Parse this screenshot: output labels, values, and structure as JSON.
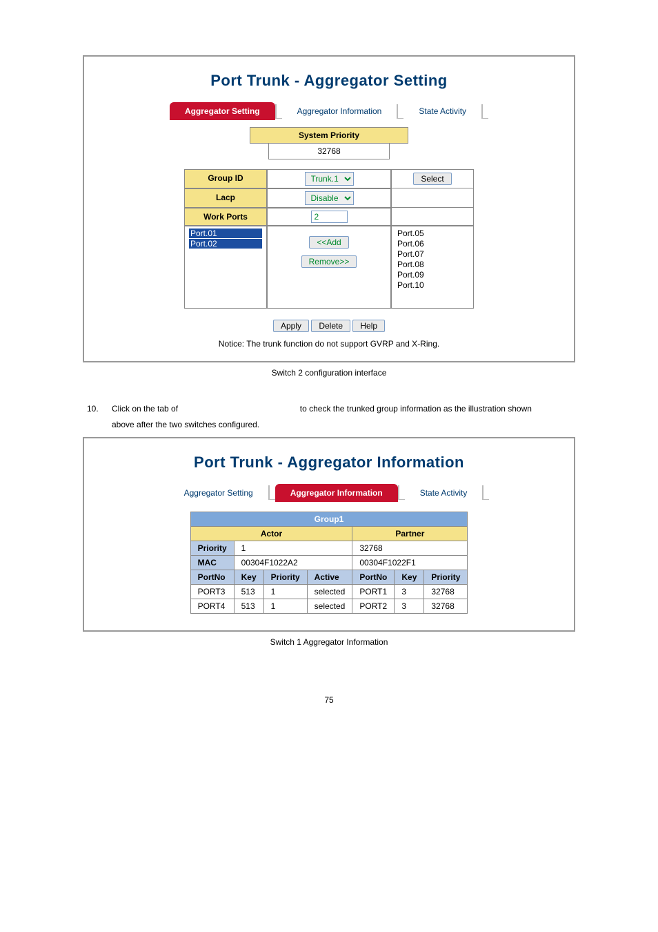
{
  "screenshot1": {
    "title": "Port Trunk - Aggregator Setting",
    "tabs": {
      "aggregator_setting": "Aggregator Setting",
      "aggregator_information": "Aggregator Information",
      "state_activity": "State Activity"
    },
    "system_priority": {
      "label": "System Priority",
      "value": "32768"
    },
    "rows": {
      "group_id": {
        "label": "Group ID",
        "value": "Trunk.1",
        "select_btn": "Select"
      },
      "lacp": {
        "label": "Lacp",
        "value": "Disable"
      },
      "work_ports": {
        "label": "Work Ports",
        "value": "2"
      }
    },
    "left_ports": [
      "Port.01",
      "Port.02"
    ],
    "right_ports": [
      "Port.05",
      "Port.06",
      "Port.07",
      "Port.08",
      "Port.09",
      "Port.10"
    ],
    "add_btn": "<<Add",
    "remove_btn": "Remove>>",
    "actions": {
      "apply": "Apply",
      "delete": "Delete",
      "help": "Help"
    },
    "notice": "Notice: The trunk function do not support GVRP and X-Ring."
  },
  "caption1": "Switch 2 configuration interface",
  "step10": {
    "num": "10.",
    "part1": "Click on the tab of",
    "part2": "to check the trunked group information as the illustration shown",
    "part3": "above after the two switches configured."
  },
  "screenshot2": {
    "title": "Port Trunk - Aggregator Information",
    "tabs": {
      "aggregator_setting": "Aggregator Setting",
      "aggregator_information": "Aggregator Information",
      "state_activity": "State Activity"
    },
    "group": "Group1",
    "actor": "Actor",
    "partner": "Partner",
    "priority": {
      "label": "Priority",
      "actor": "1",
      "partner": "32768"
    },
    "mac": {
      "label": "MAC",
      "actor": "00304F1022A2",
      "partner": "00304F1022F1"
    },
    "cols": {
      "portno": "PortNo",
      "key": "Key",
      "priority": "Priority",
      "active": "Active"
    },
    "rows": [
      {
        "a_port": "PORT3",
        "a_key": "513",
        "a_pri": "1",
        "a_act": "selected",
        "p_port": "PORT1",
        "p_key": "3",
        "p_pri": "32768"
      },
      {
        "a_port": "PORT4",
        "a_key": "513",
        "a_pri": "1",
        "a_act": "selected",
        "p_port": "PORT2",
        "p_key": "3",
        "p_pri": "32768"
      }
    ]
  },
  "caption2": "Switch 1 Aggregator Information",
  "page_number": "75"
}
